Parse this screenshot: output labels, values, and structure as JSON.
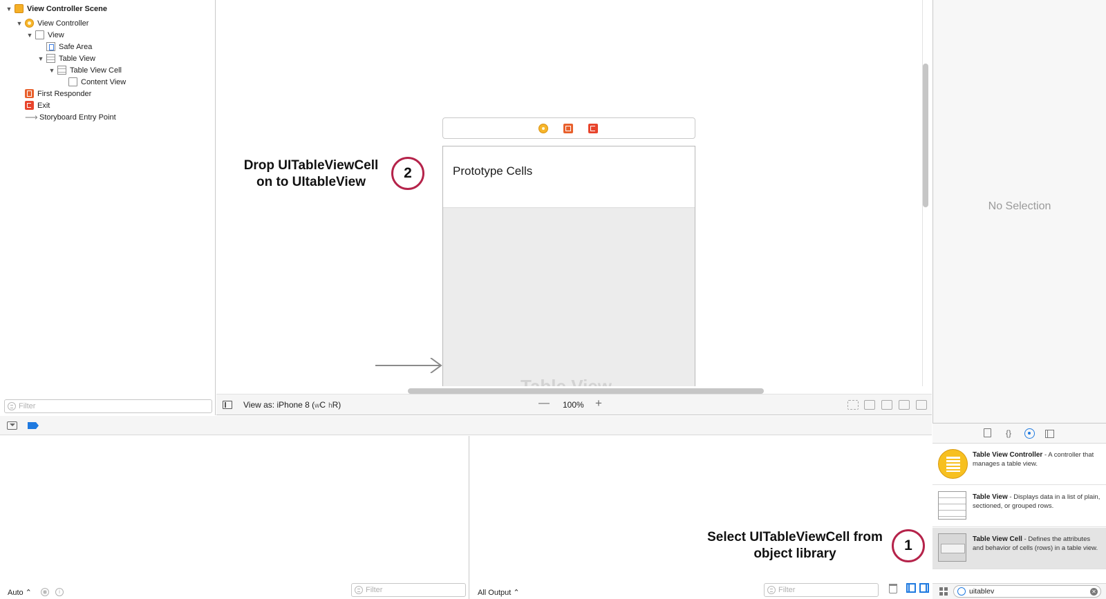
{
  "outline": {
    "items": [
      {
        "label": "View Controller Scene",
        "icon": "scene-icon"
      },
      {
        "label": "View Controller",
        "icon": "view-controller-icon"
      },
      {
        "label": "View",
        "icon": "view-icon"
      },
      {
        "label": "Safe Area",
        "icon": "safe-area-icon"
      },
      {
        "label": "Table View",
        "icon": "table-view-icon"
      },
      {
        "label": "Table View Cell",
        "icon": "table-view-cell-icon"
      },
      {
        "label": "Content View",
        "icon": "view-icon"
      },
      {
        "label": "First Responder",
        "icon": "first-responder-icon"
      },
      {
        "label": "Exit",
        "icon": "exit-icon"
      },
      {
        "label": "Storyboard Entry Point",
        "icon": "arrow-right-icon"
      }
    ],
    "filter_placeholder": "Filter"
  },
  "canvas": {
    "prototype_header": "Prototype Cells",
    "table_view_label": "Table View",
    "callout_drop": "Drop UITableViewCell on to UItableView",
    "callout_drop_line1": "Drop UITableViewCell",
    "callout_drop_line2": "on to UItableView",
    "badge_drop": "2",
    "callout_select_line1": "Select UITableViewCell from",
    "callout_select_line2": "object library",
    "badge_select": "1"
  },
  "canvas_bar": {
    "view_as_prefix": "View as: iPhone 8 (",
    "size_w": "w",
    "size_c": "C",
    "size_h": "h",
    "size_r": "R)",
    "zoom_minus": "—",
    "zoom": "100%",
    "zoom_plus": "+"
  },
  "debug": {
    "auto_label": "Auto ⌃",
    "auto_text": "Auto",
    "filter_placeholder": "Filter",
    "output_label": "All Output",
    "console_filter_placeholder": "Filter"
  },
  "inspector": {
    "no_selection": "No Selection"
  },
  "library": {
    "items": [
      {
        "title": "Table View Controller",
        "desc": " - A controller that manages a table view."
      },
      {
        "title": "Table View",
        "desc": " - Displays data in a list of plain, sectioned, or grouped rows."
      },
      {
        "title": "Table View Cell",
        "desc": " - Defines the attributes and behavior of cells (rows) in a table view."
      }
    ],
    "search_value": "uitablev",
    "clear_glyph": "✕"
  },
  "colors": {
    "accent": "#1f7ae0",
    "badge_ring": "#b5234a",
    "view_controller": "#f7b52a",
    "first_responder": "#e8602c",
    "exit": "#e8442c"
  }
}
